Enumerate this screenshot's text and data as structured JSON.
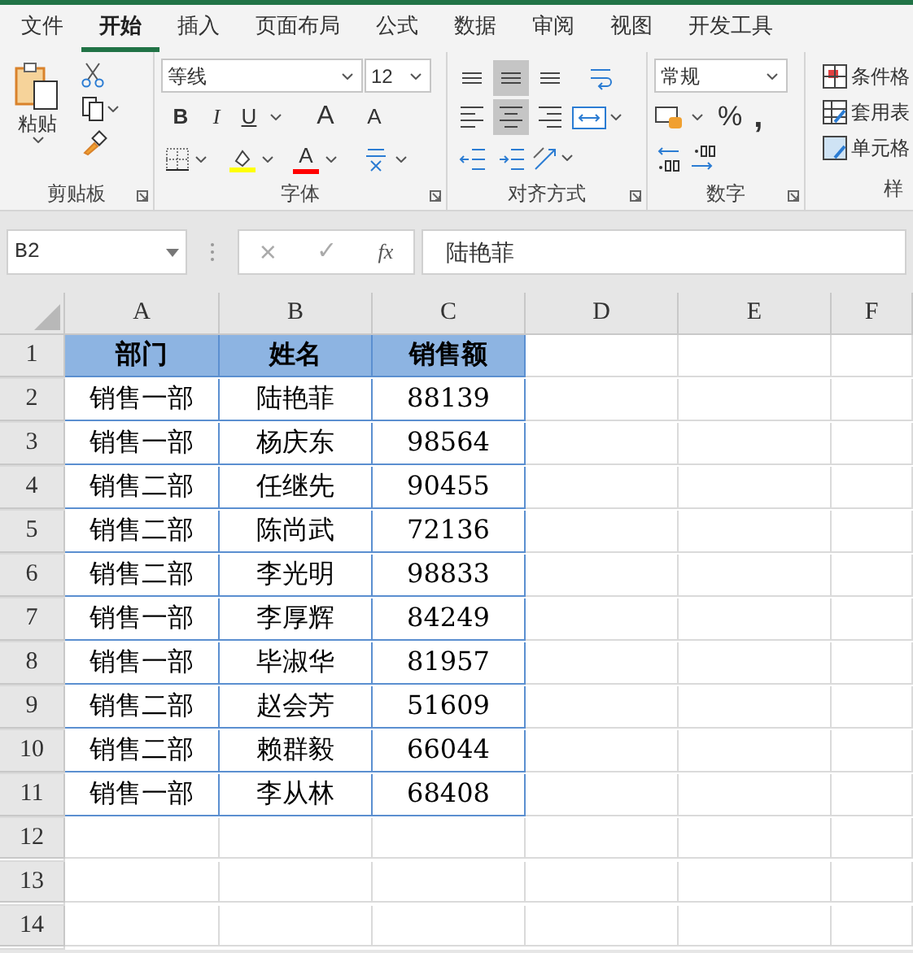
{
  "tabs": [
    {
      "label": "文件",
      "selected": false
    },
    {
      "label": "开始",
      "selected": true
    },
    {
      "label": "插入",
      "selected": false
    },
    {
      "label": "页面布局",
      "selected": false
    },
    {
      "label": "公式",
      "selected": false
    },
    {
      "label": "数据",
      "selected": false
    },
    {
      "label": "审阅",
      "selected": false
    },
    {
      "label": "视图",
      "selected": false
    },
    {
      "label": "开发工具",
      "selected": false
    }
  ],
  "ribbon": {
    "clipboard": {
      "paste_label": "粘贴",
      "label": "剪贴板"
    },
    "font": {
      "font_name": "等线",
      "font_size": "12",
      "bold": "B",
      "italic": "I",
      "underline": "U",
      "grow": "A",
      "shrink": "A",
      "font_color": "A",
      "label": "字体"
    },
    "alignment": {
      "buttons": [
        {
          "kind": "top",
          "selected": false
        },
        {
          "kind": "middle",
          "selected": true
        },
        {
          "kind": "bottom",
          "selected": false
        },
        {
          "kind": "wrap",
          "selected": false
        },
        {
          "kind": "left",
          "selected": false
        },
        {
          "kind": "center",
          "selected": true
        },
        {
          "kind": "right",
          "selected": false
        },
        {
          "kind": "merge",
          "selected": false
        },
        {
          "kind": "outdent",
          "selected": false
        },
        {
          "kind": "indent",
          "selected": false
        },
        {
          "kind": "orientation",
          "selected": false
        }
      ],
      "label": "对齐方式"
    },
    "number": {
      "format": "常规",
      "percent": "%",
      "comma": ",",
      "label": "数字"
    },
    "styles": {
      "buttons": [
        "条件格",
        "套用表",
        "单元格"
      ],
      "label": "样"
    }
  },
  "formula_bar": {
    "name_box": "B2",
    "cancel": "×",
    "enter": "✓",
    "fx": "fx",
    "formula": "陆艳菲"
  },
  "sheet": {
    "columns": [
      "A",
      "B",
      "C",
      "D",
      "E",
      "F"
    ],
    "rows": [
      {
        "number": "1",
        "kind": "header",
        "cells": [
          "部门",
          "姓名",
          "销售额"
        ]
      },
      {
        "number": "2",
        "kind": "data",
        "cells": [
          "销售一部",
          "陆艳菲",
          "88139"
        ]
      },
      {
        "number": "3",
        "kind": "data",
        "cells": [
          "销售一部",
          "杨庆东",
          "98564"
        ]
      },
      {
        "number": "4",
        "kind": "data",
        "cells": [
          "销售二部",
          "任继先",
          "90455"
        ]
      },
      {
        "number": "5",
        "kind": "data",
        "cells": [
          "销售二部",
          "陈尚武",
          "72136"
        ]
      },
      {
        "number": "6",
        "kind": "data",
        "cells": [
          "销售二部",
          "李光明",
          "98833"
        ]
      },
      {
        "number": "7",
        "kind": "data",
        "cells": [
          "销售一部",
          "李厚辉",
          "84249"
        ]
      },
      {
        "number": "8",
        "kind": "data",
        "cells": [
          "销售一部",
          "毕淑华",
          "81957"
        ]
      },
      {
        "number": "9",
        "kind": "data",
        "cells": [
          "销售二部",
          "赵会芳",
          "51609"
        ]
      },
      {
        "number": "10",
        "kind": "data",
        "cells": [
          "销售二部",
          "赖群毅",
          "66044"
        ]
      },
      {
        "number": "11",
        "kind": "data",
        "cells": [
          "销售一部",
          "李从林",
          "68408"
        ]
      },
      {
        "number": "12",
        "kind": "empty"
      },
      {
        "number": "13",
        "kind": "empty"
      },
      {
        "number": "14",
        "kind": "empty"
      }
    ]
  }
}
